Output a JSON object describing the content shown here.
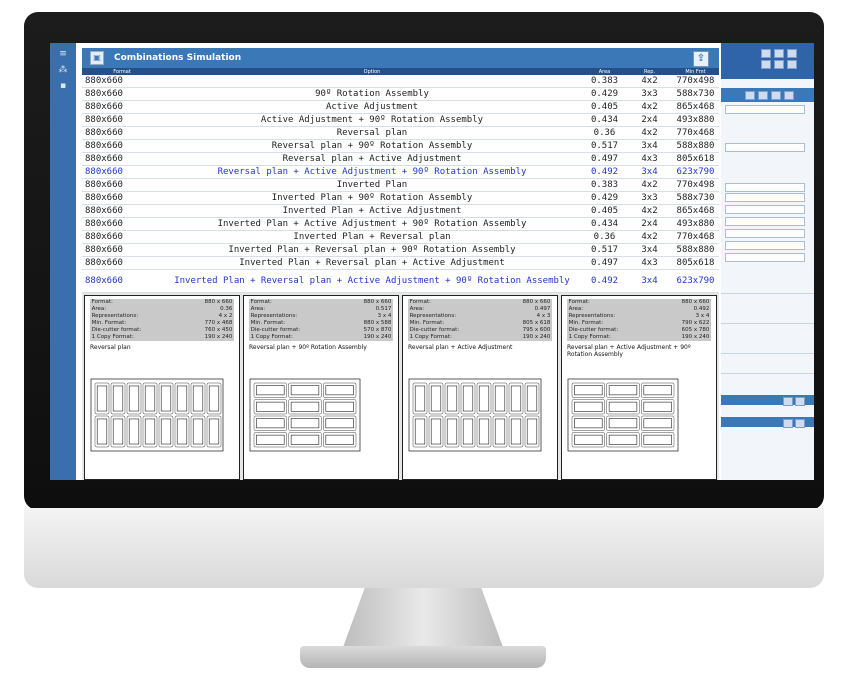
{
  "window": {
    "title": "Combinations Simulation"
  },
  "table": {
    "headers": [
      "Format",
      "Option",
      "Area",
      "Rep.",
      "Min Fmt"
    ],
    "rows": [
      {
        "format": "880x660",
        "option": "",
        "area": "0.383",
        "rep": "4x2",
        "min": "770x498"
      },
      {
        "format": "880x660",
        "option": "90º Rotation Assembly",
        "area": "0.429",
        "rep": "3x3",
        "min": "588x730"
      },
      {
        "format": "880x660",
        "option": "Active Adjustment",
        "area": "0.405",
        "rep": "4x2",
        "min": "865x468"
      },
      {
        "format": "880x660",
        "option": "Active Adjustment + 90º Rotation Assembly",
        "area": "0.434",
        "rep": "2x4",
        "min": "493x880"
      },
      {
        "format": "880x660",
        "option": "Reversal plan",
        "area": "0.36",
        "rep": "4x2",
        "min": "770x468"
      },
      {
        "format": "880x660",
        "option": "Reversal plan + 90º Rotation Assembly",
        "area": "0.517",
        "rep": "3x4",
        "min": "588x880"
      },
      {
        "format": "880x660",
        "option": "Reversal plan + Active Adjustment",
        "area": "0.497",
        "rep": "4x3",
        "min": "805x618"
      },
      {
        "format": "880x660",
        "option": "Reversal plan + Active Adjustment + 90º Rotation Assembly",
        "area": "0.492",
        "rep": "3x4",
        "min": "623x790"
      },
      {
        "format": "880x660",
        "option": "Inverted Plan",
        "area": "0.383",
        "rep": "4x2",
        "min": "770x498"
      },
      {
        "format": "880x660",
        "option": "Inverted Plan + 90º Rotation Assembly",
        "area": "0.429",
        "rep": "3x3",
        "min": "588x730"
      },
      {
        "format": "880x660",
        "option": "Inverted Plan + Active Adjustment",
        "area": "0.405",
        "rep": "4x2",
        "min": "865x468"
      },
      {
        "format": "880x660",
        "option": "Inverted Plan + Active Adjustment + 90º Rotation Assembly",
        "area": "0.434",
        "rep": "2x4",
        "min": "493x880"
      },
      {
        "format": "880x660",
        "option": "Inverted Plan + Reversal plan",
        "area": "0.36",
        "rep": "4x2",
        "min": "770x468"
      },
      {
        "format": "880x660",
        "option": "Inverted Plan + Reversal plan + 90º Rotation Assembly",
        "area": "0.517",
        "rep": "3x4",
        "min": "588x880"
      },
      {
        "format": "880x660",
        "option": "Inverted Plan + Reversal plan + Active Adjustment",
        "area": "0.497",
        "rep": "4x3",
        "min": "805x618"
      },
      {
        "format": "880x660",
        "option": "Inverted Plan + Reversal plan + Active Adjustment + 90º Rotation Assembly",
        "area": "0.492",
        "rep": "3x4",
        "min": "623x790"
      }
    ]
  },
  "cards": [
    {
      "labels": [
        "Format:",
        "Area:",
        "Representations:",
        "Min. Format:",
        "Die-cutter format:",
        "1 Copy Format:"
      ],
      "values": [
        "880 x 660",
        "0.36",
        "4  x  2",
        "770 x 468",
        "760 x 450",
        "190 x 240"
      ],
      "title": "Reversal plan",
      "cols": 8,
      "rows": 2
    },
    {
      "labels": [
        "Format:",
        "Area:",
        "Representations:",
        "Min. Format:",
        "Die-cutter format:",
        "1 Copy Format:"
      ],
      "values": [
        "880 x 660",
        "0.517",
        "3  x  4",
        "880 x 588",
        "570 x 870",
        "190 x 240"
      ],
      "title": "Reversal plan + 90º Rotation Assembly",
      "cols": 3,
      "rows": 4
    },
    {
      "labels": [
        "Format:",
        "Area:",
        "Representations:",
        "Min. Format:",
        "Die-cutter format:",
        "1 Copy Format:"
      ],
      "values": [
        "880 x 660",
        "0.497",
        "4  x  3",
        "805 x 618",
        "795 x 600",
        "190 x 240"
      ],
      "title": "Reversal plan + Active Adjustment",
      "cols": 8,
      "rows": 2
    },
    {
      "labels": [
        "Format:",
        "Area:",
        "Representations:",
        "Min. Format:",
        "Die-cutter format:",
        "1 Copy Format:"
      ],
      "values": [
        "880 x 660",
        "0.492",
        "3  x  4",
        "790 x 622",
        "605 x 780",
        "190 x 240"
      ],
      "title": "Reversal plan + Active Adjustment + 90º Rotation Assembly",
      "cols": 3,
      "rows": 4
    }
  ],
  "colors": {
    "titlebar": "#3a78b8",
    "header": "#24508a",
    "selected_text": "#2036c8"
  },
  "icons": {
    "app": "window-icon",
    "export": "export-icon"
  }
}
